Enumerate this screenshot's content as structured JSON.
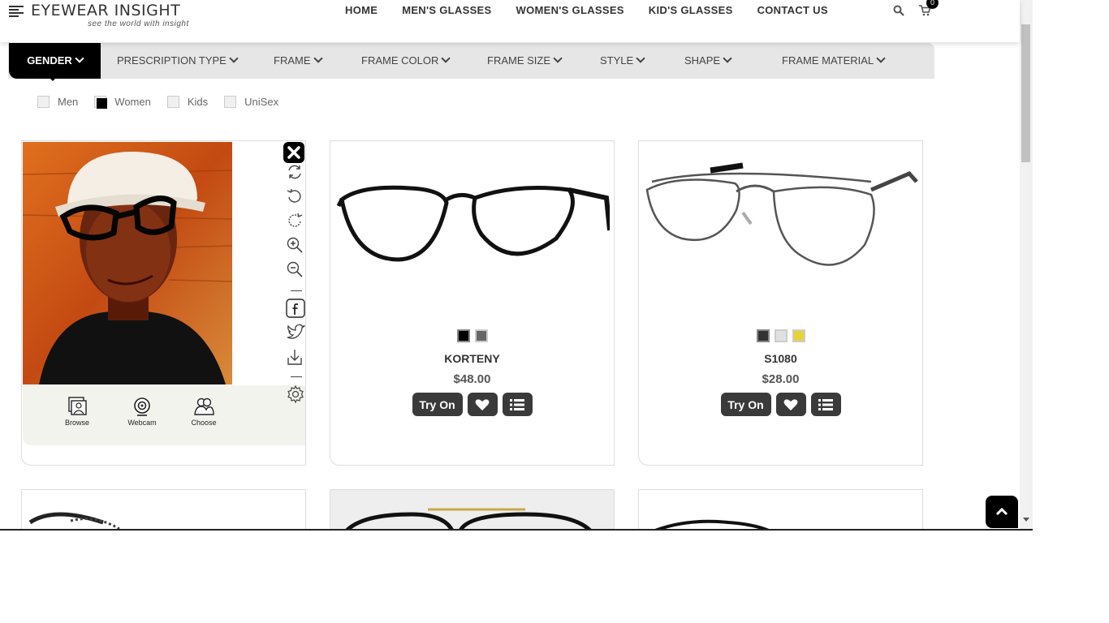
{
  "header": {
    "logo_title": "EYEWEAR INSIGHT",
    "logo_tagline": "see the world with insight",
    "nav": [
      "HOME",
      "MEN'S GLASSES",
      "WOMEN'S GLASSES",
      "KID'S GLASSES",
      "CONTACT US"
    ],
    "cart_count": "0"
  },
  "filters": [
    "GENDER",
    "PRESCRIPTION TYPE",
    "FRAME",
    "FRAME COLOR",
    "FRAME SIZE",
    "STYLE",
    "SHAPE",
    "FRAME MATERIAL"
  ],
  "gender_options": [
    {
      "label": "Men",
      "checked": false
    },
    {
      "label": "Women",
      "checked": true
    },
    {
      "label": "Kids",
      "checked": false
    },
    {
      "label": "UniSex",
      "checked": false
    }
  ],
  "tryon": {
    "sources": [
      "Browse",
      "Webcam",
      "Choose"
    ]
  },
  "products": [
    {
      "name": "KORTENY",
      "price": "$48.00",
      "swatches": [
        "#000000",
        "#666666"
      ],
      "try_label": "Try On"
    },
    {
      "name": "S1080",
      "price": "$28.00",
      "swatches": [
        "#333333",
        "#e0e0e0",
        "#e8d23a"
      ],
      "try_label": "Try On"
    }
  ]
}
